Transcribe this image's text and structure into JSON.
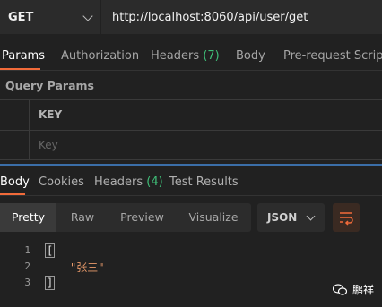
{
  "request": {
    "method": "GET",
    "url": "http://localhost:8060/api/user/get"
  },
  "request_tabs": [
    {
      "label": "Params",
      "active": true
    },
    {
      "label": "Authorization"
    },
    {
      "label": "Headers",
      "count": "(7)"
    },
    {
      "label": "Body"
    },
    {
      "label": "Pre-request Script"
    }
  ],
  "query_params": {
    "title": "Query Params",
    "header_key": "KEY",
    "key_placeholder": "Key"
  },
  "response_tabs": [
    {
      "label": "Body",
      "active": true
    },
    {
      "label": "Cookies"
    },
    {
      "label": "Headers",
      "count": "(4)"
    },
    {
      "label": "Test Results"
    }
  ],
  "view_modes": [
    "Pretty",
    "Raw",
    "Preview",
    "Visualize"
  ],
  "format": "JSON",
  "code_lines": [
    {
      "num": "1",
      "text": "["
    },
    {
      "num": "2",
      "text": "\"张三\""
    },
    {
      "num": "3",
      "text": "]"
    }
  ],
  "watermark": {
    "text": "鹏祥"
  },
  "colors": {
    "accent": "#f26b3a",
    "count_green": "#3fbf78",
    "string": "#e89a6a"
  }
}
